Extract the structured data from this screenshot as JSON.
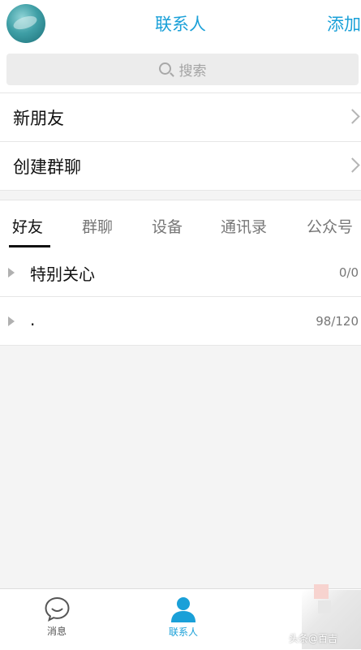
{
  "header": {
    "title": "联系人",
    "add_label": "添加"
  },
  "search": {
    "placeholder": "搜索"
  },
  "menu": {
    "new_friends": "新朋友",
    "create_group_chat": "创建群聊"
  },
  "tabs": [
    {
      "label": "好友",
      "active": true
    },
    {
      "label": "群聊",
      "active": false
    },
    {
      "label": "设备",
      "active": false
    },
    {
      "label": "通讯录",
      "active": false
    },
    {
      "label": "公众号",
      "active": false
    }
  ],
  "groups": [
    {
      "name": "特别关心",
      "count": "0/0"
    },
    {
      "name": ".",
      "count": "98/120"
    }
  ],
  "bottom_nav": [
    {
      "label": "消息",
      "icon": "message-icon",
      "active": false
    },
    {
      "label": "联系人",
      "icon": "contact-icon",
      "active": true
    }
  ],
  "watermark": {
    "text": "头条@百吉"
  },
  "colors": {
    "accent": "#1aa0d8",
    "background": "#f4f4f4",
    "divider": "#e6e6e6"
  }
}
